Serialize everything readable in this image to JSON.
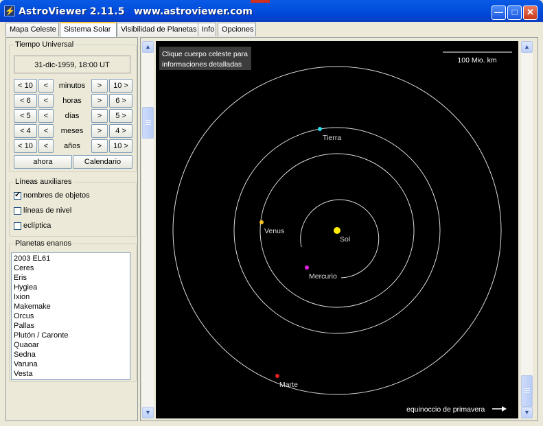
{
  "window": {
    "title": "AstroViewer 2.11.5",
    "url": "www.astroviewer.com",
    "minimize_glyph": "—",
    "maximize_glyph": "□",
    "close_glyph": "✕"
  },
  "tabs": [
    {
      "label": "Mapa Celeste"
    },
    {
      "label": "Sistema Solar"
    },
    {
      "label": "Visibilidad de Planetas"
    },
    {
      "label": "Info"
    },
    {
      "label": "Opciones"
    }
  ],
  "time_panel": {
    "legend": "Tiempo Universal",
    "datetime": "31-dic-1959, 18:00 UT",
    "rows": [
      {
        "back_big": "< 10",
        "back": "<",
        "unit": "minutos",
        "fwd": ">",
        "fwd_big": "10 >"
      },
      {
        "back_big": "< 6",
        "back": "<",
        "unit": "horas",
        "fwd": ">",
        "fwd_big": "6 >"
      },
      {
        "back_big": "< 5",
        "back": "<",
        "unit": "días",
        "fwd": ">",
        "fwd_big": "5 >"
      },
      {
        "back_big": "< 4",
        "back": "<",
        "unit": "meses",
        "fwd": ">",
        "fwd_big": "4 >"
      },
      {
        "back_big": "< 10",
        "back": "<",
        "unit": "años",
        "fwd": ">",
        "fwd_big": "10 >"
      }
    ],
    "now_button": "ahora",
    "calendar_button": "Calendario"
  },
  "aux_lines": {
    "legend": "Líneas auxiliares",
    "options": [
      {
        "label": "nombres de objetos",
        "checked": true
      },
      {
        "label": "líneas de nivel",
        "checked": false
      },
      {
        "label": "eclíptica",
        "checked": false
      }
    ]
  },
  "dwarf_planets": {
    "legend": "Planetas enanos",
    "items": [
      "2003 EL61",
      "Ceres",
      "Eris",
      "Hygiea",
      "Ixion",
      "Makemake",
      "Orcus",
      "Pallas",
      "Plutón / Caronte",
      "Quaoar",
      "Sedna",
      "Varuna",
      "Vesta"
    ]
  },
  "view": {
    "hint_line1": "Clique cuerpo celeste para",
    "hint_line2": "informaciones detalladas",
    "scale_label": "100 Mio. km",
    "equinox_label": "equinoccio de primavera",
    "bodies": {
      "sun": {
        "label": "Sol",
        "color": "#ffee00"
      },
      "mercury": {
        "label": "Mercurio",
        "color": "#e020e0"
      },
      "venus": {
        "label": "Venus",
        "color": "#f0c020"
      },
      "earth": {
        "label": "Tierra",
        "color": "#20e0f0"
      },
      "mars": {
        "label": "Marte",
        "color": "#e82020"
      }
    }
  }
}
